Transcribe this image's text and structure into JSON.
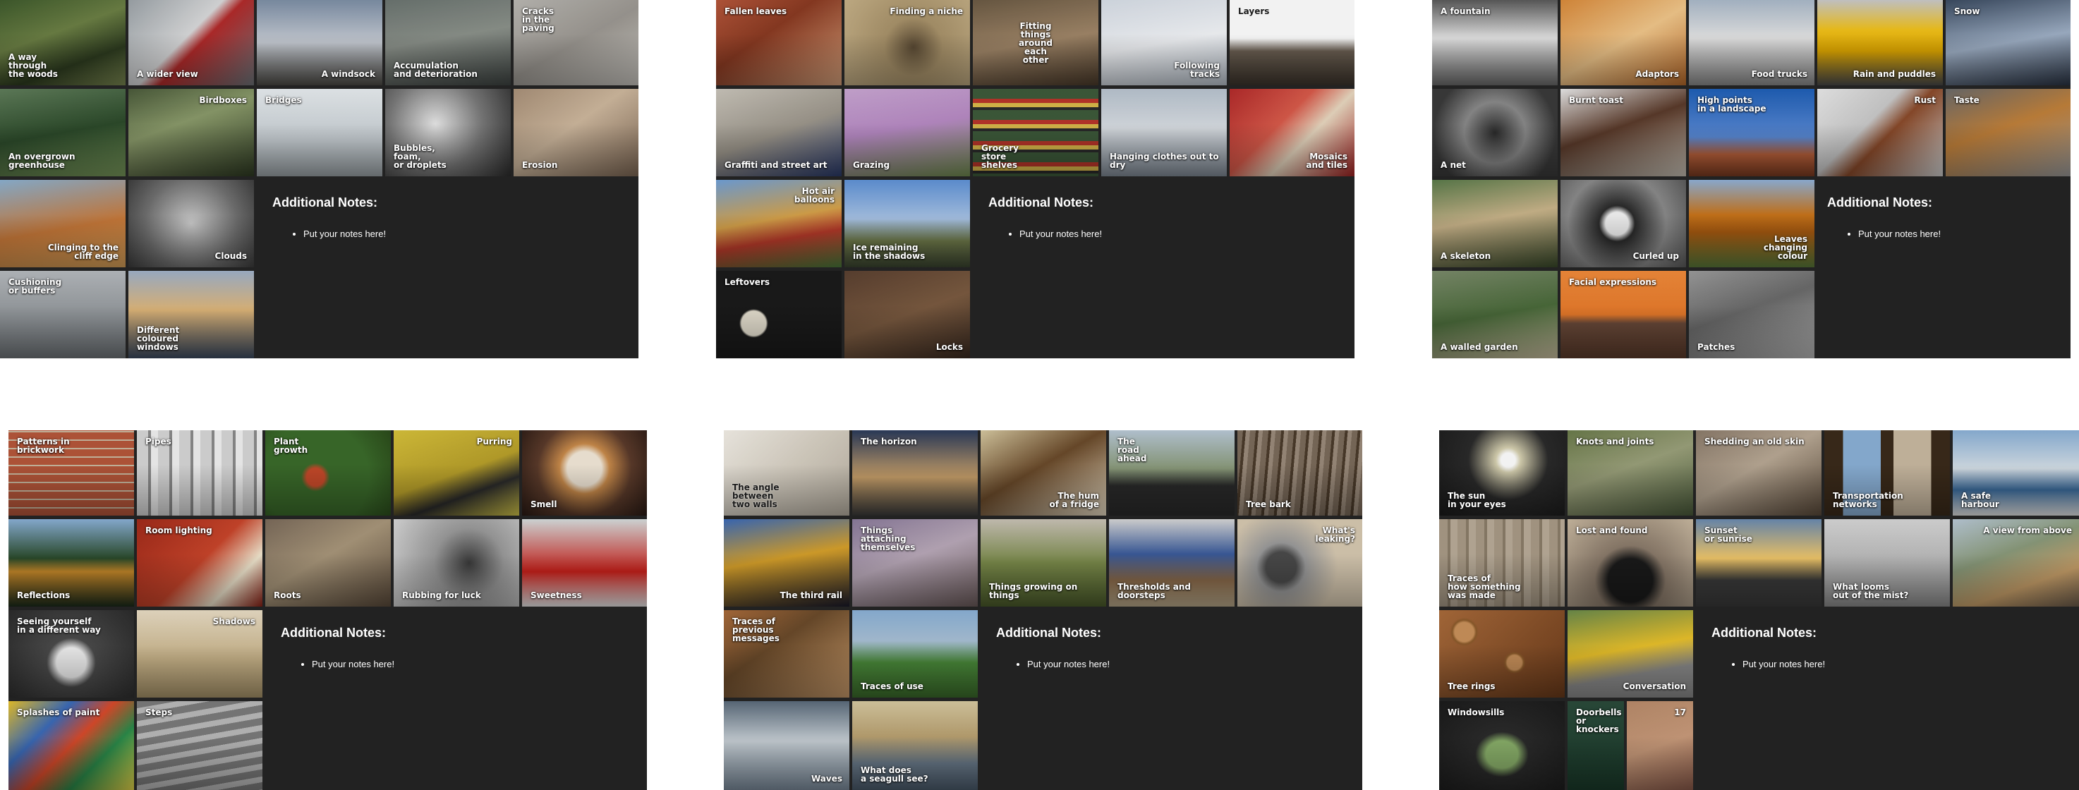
{
  "boards": [
    {
      "notes_title": "Additional Notes:",
      "notes_items": [
        "Put your notes here!"
      ],
      "tiles": [
        {
          "caption": "A way\nthrough\nthe woods",
          "image": "woods-photo"
        },
        {
          "caption": "A wider view",
          "image": "side-mirror-photo"
        },
        {
          "caption": "A windsock",
          "image": "windsock-photo"
        },
        {
          "caption": "Accumulation\nand deterioration",
          "image": "dashboard-photo"
        },
        {
          "caption": "Cracks\nin the\npaving",
          "image": "cracked-paving-photo"
        },
        {
          "caption": "An overgrown\ngreenhouse",
          "image": "greenhouse-photo"
        },
        {
          "caption": "Birdboxes",
          "image": "birdbox-photo"
        },
        {
          "caption": "Bridges",
          "image": "bridge-photo"
        },
        {
          "caption": "Bubbles,\nfoam,\nor droplets",
          "image": "droplets-photo"
        },
        {
          "caption": "Erosion",
          "image": "erosion-photo"
        },
        {
          "caption": "Clinging to the\ncliff edge",
          "image": "cliff-tree-photo"
        },
        {
          "caption": "Clouds",
          "image": "clouds-photo"
        },
        {
          "caption": "Cushioning\nor buffers",
          "image": "buffers-photo"
        },
        {
          "caption": "Different\ncoloured\nwindows",
          "image": "windows-photo"
        }
      ]
    },
    {
      "notes_title": "Additional Notes:",
      "notes_items": [
        "Put your notes here!"
      ],
      "tiles": [
        {
          "caption": "Fallen leaves",
          "image": "fallen-leaves-photo"
        },
        {
          "caption": "Finding a niche",
          "image": "niche-photo"
        },
        {
          "caption": "Fitting things\naround\neach\nother",
          "image": "fitting-things-photo"
        },
        {
          "caption": "Following\ntracks",
          "image": "snow-tracks-photo"
        },
        {
          "caption": "Layers",
          "image": "layers-photo"
        },
        {
          "caption": "Graffiti and street art",
          "image": "graffiti-photo"
        },
        {
          "caption": "Grazing",
          "image": "grazing-deer-photo"
        },
        {
          "caption": "Grocery\nstore\nshelves",
          "image": "grocery-shelves-photo"
        },
        {
          "caption": "Hanging clothes out to dry",
          "image": "washing-line-photo"
        },
        {
          "caption": "Mosaics\nand tiles",
          "image": "mosaic-photo"
        },
        {
          "caption": "Hot air\nballoons",
          "image": "balloons-photo"
        },
        {
          "caption": "Ice remaining\nin the shadows",
          "image": "ice-shadows-photo"
        },
        {
          "caption": "Leftovers",
          "image": "leftovers-photo"
        },
        {
          "caption": "Locks",
          "image": "locks-photo"
        }
      ]
    },
    {
      "notes_title": "Additional Notes:",
      "notes_items": [
        "Put your notes here!"
      ],
      "tiles": [
        {
          "caption": "A fountain",
          "image": "fountain-photo"
        },
        {
          "caption": "Adaptors",
          "image": "adaptor-photo"
        },
        {
          "caption": "Food trucks",
          "image": "food-trucks-photo"
        },
        {
          "caption": "Rain and puddles",
          "image": "school-bus-photo"
        },
        {
          "caption": "Snow",
          "image": "snowy-path-photo"
        },
        {
          "caption": "A net",
          "image": "net-photo"
        },
        {
          "caption": "Burnt toast",
          "image": "toast-photo"
        },
        {
          "caption": "High points\nin a landscape",
          "image": "mesa-photo"
        },
        {
          "caption": "Rust",
          "image": "rust-photo"
        },
        {
          "caption": "Taste",
          "image": "dog-taste-photo"
        },
        {
          "caption": "A skeleton",
          "image": "skeleton-photo"
        },
        {
          "caption": "Curled up",
          "image": "cat-curled-photo"
        },
        {
          "caption": "Leaves\nchanging\ncolour",
          "image": "autumn-tree-photo"
        },
        {
          "caption": "A walled garden",
          "image": "walled-garden-photo"
        },
        {
          "caption": "Facial expressions",
          "image": "socket-face-photo"
        },
        {
          "caption": "Patches",
          "image": "patched-road-photo"
        }
      ]
    },
    {
      "notes_title": "Additional Notes:",
      "notes_items": [
        "Put your notes here!"
      ],
      "tiles": [
        {
          "caption": "Patterns in\nbrickwork",
          "image": "brickwork-photo"
        },
        {
          "caption": "Pipes",
          "image": "pipes-photo"
        },
        {
          "caption": "Plant\ngrowth",
          "image": "plant-growth-photo"
        },
        {
          "caption": "Purring",
          "image": "purring-cat-photo"
        },
        {
          "caption": "Smell",
          "image": "dog-smell-photo"
        },
        {
          "caption": "Reflections",
          "image": "lake-reflection-photo"
        },
        {
          "caption": "Room lighting",
          "image": "room-lamp-photo"
        },
        {
          "caption": "Roots",
          "image": "roots-photo"
        },
        {
          "caption": "Rubbing for luck",
          "image": "statue-luck-photo"
        },
        {
          "caption": "Sweetness",
          "image": "hummingbird-photo"
        },
        {
          "caption": "Seeing yourself\nin a different way",
          "image": "mirror-face-photo"
        },
        {
          "caption": "Shadows",
          "image": "beach-shadows-photo"
        },
        {
          "caption": "Splashes of paint",
          "image": "paint-splashes-photo"
        },
        {
          "caption": "Steps",
          "image": "steps-photo"
        }
      ]
    },
    {
      "notes_title": "Additional Notes:",
      "notes_items": [
        "Put your notes here!"
      ],
      "tiles": [
        {
          "caption": "The angle\nbetween\ntwo walls",
          "image": "wall-angle-photo"
        },
        {
          "caption": "The horizon",
          "image": "horizon-photo"
        },
        {
          "caption": "The hum\nof a fridge",
          "image": "fridge-photo"
        },
        {
          "caption": "The\nroad\nahead",
          "image": "road-ahead-photo"
        },
        {
          "caption": "Tree bark",
          "image": "tree-bark-photo"
        },
        {
          "caption": "The third rail",
          "image": "third-rail-photo"
        },
        {
          "caption": "Things\nattaching\nthemselves",
          "image": "burrs-photo"
        },
        {
          "caption": "Things growing on things",
          "image": "moss-photo"
        },
        {
          "caption": "Thresholds and doorsteps",
          "image": "doorstep-photo"
        },
        {
          "caption": "What's\nleaking?",
          "image": "tap-leak-photo"
        },
        {
          "caption": "Traces of\nprevious\nmessages",
          "image": "posters-photo"
        },
        {
          "caption": "Traces of use",
          "image": "worn-lawn-photo"
        },
        {
          "caption": "Waves",
          "image": "waves-photo"
        },
        {
          "caption": "What does\na seagull see?",
          "image": "seagull-view-photo"
        }
      ]
    },
    {
      "notes_title": "Additional Notes:",
      "notes_items": [
        "Put your notes here!"
      ],
      "tiles": [
        {
          "caption": "The sun\nin your eyes",
          "image": "sun-glare-photo"
        },
        {
          "caption": "Knots and joints",
          "image": "knots-photo"
        },
        {
          "caption": "Shedding an old skin",
          "image": "snake-skin-photo"
        },
        {
          "caption": "Transportation\nnetworks",
          "image": "train-window-photo"
        },
        {
          "caption": "A safe\nharbour",
          "image": "harbour-photo"
        },
        {
          "caption": "Traces of\nhow something\nwas made",
          "image": "wood-grain-photo"
        },
        {
          "caption": "Lost and found",
          "image": "gate-photo"
        },
        {
          "caption": "Sunset\nor sunrise",
          "image": "sunset-photo"
        },
        {
          "caption": "What looms\nout of the mist?",
          "image": "mist-photo"
        },
        {
          "caption": "A view from above",
          "image": "view-above-photo"
        },
        {
          "caption": "Tree rings",
          "image": "log-pile-photo"
        },
        {
          "caption": "Conversation",
          "image": "street-conversation-photo"
        },
        {
          "caption": "Windowsills",
          "image": "windowsill-photo"
        },
        {
          "caption": "Doorbells\nor knockers",
          "image": "door-knocker-photo"
        },
        {
          "caption": "17",
          "image": "house-number-photo"
        }
      ]
    }
  ]
}
